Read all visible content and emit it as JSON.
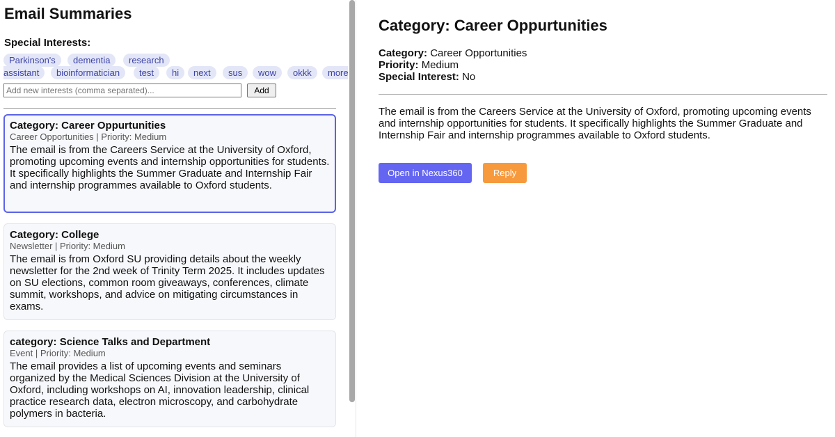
{
  "app": {
    "title": "Email Summaries"
  },
  "interests": {
    "label": "Special Interests:",
    "chips": [
      "Parkinson's",
      "dementia",
      "research",
      "assistant",
      "bioinformatician",
      "test",
      "hi",
      "next",
      "sus",
      "wow",
      "okkk",
      "more"
    ],
    "input_placeholder": "Add new interests (comma separated)...",
    "add_label": "Add"
  },
  "emails": [
    {
      "title": "Category: Career Oppurtunities",
      "meta": "Career Opportunities | Priority: Medium",
      "summary": "The email is from the Careers Service at the University of Oxford, promoting upcoming events and internship opportunities for students. It specifically highlights the Summer Graduate and Internship Fair and internship programmes available to Oxford students."
    },
    {
      "title": "Category: College",
      "meta": "Newsletter | Priority: Medium",
      "summary": "The email is from Oxford SU providing details about the weekly newsletter for the 2nd week of Trinity Term 2025. It includes updates on SU elections, common room giveaways, conferences, climate summit, workshops, and advice on mitigating circumstances in exams."
    },
    {
      "title": "category: Science Talks and Department",
      "meta": "Event | Priority: Medium",
      "summary": "The email provides a list of upcoming events and seminars organized by the Medical Sciences Division at the University of Oxford, including workshops on AI, innovation leadership, clinical practice research data, electron microscopy, and carbohydrate polymers in bacteria."
    }
  ],
  "detail": {
    "heading": "Category: Career Oppurtunities",
    "category_label": "Category:",
    "category_value": "Career Opportunities",
    "priority_label": "Priority:",
    "priority_value": "Medium",
    "special_label": "Special Interest:",
    "special_value": "No",
    "summary": "The email is from the Careers Service at the University of Oxford, promoting upcoming events and internship opportunities for students. It specifically highlights the Summer Graduate and Internship Fair and internship programmes available to Oxford students.",
    "open_label": "Open in Nexus360",
    "reply_label": "Reply"
  },
  "colors": {
    "accent": "#6466f1",
    "reply": "#f79a3e",
    "chip_bg": "#e3e6f7",
    "chip_text": "#3d44a8",
    "selected_border": "#5b63e6"
  }
}
